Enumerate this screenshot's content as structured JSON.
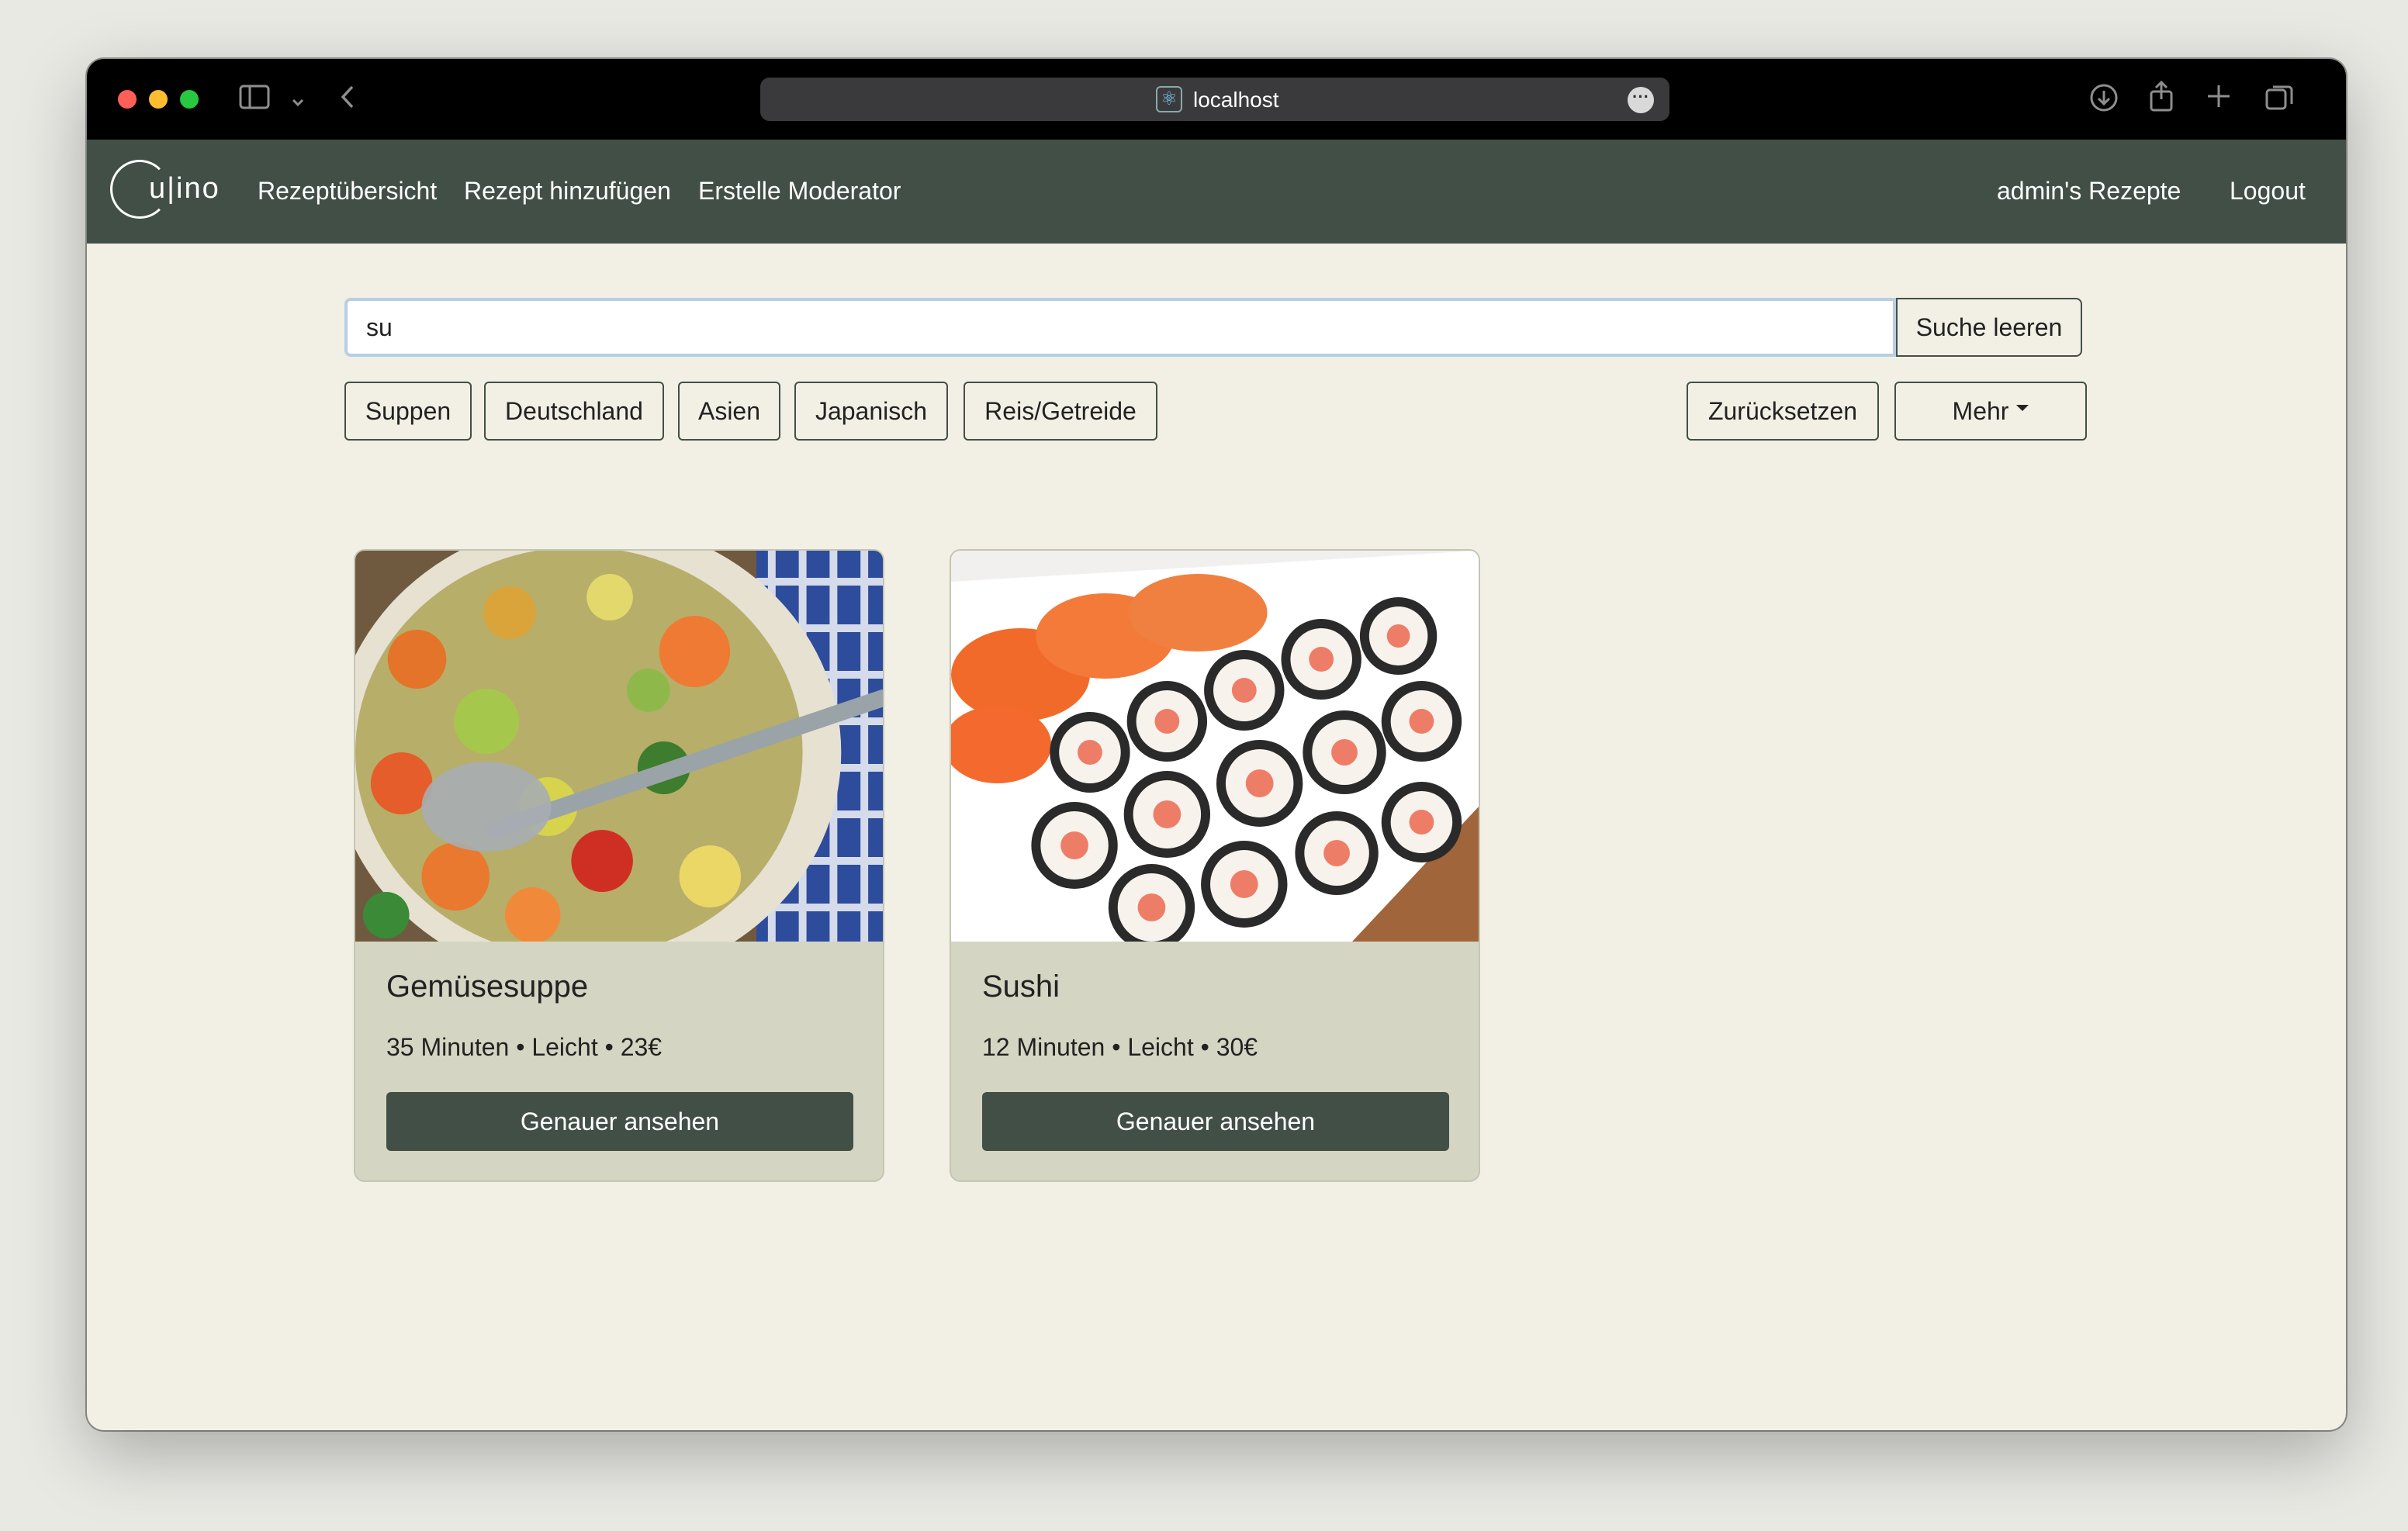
{
  "browser": {
    "url": "localhost"
  },
  "navbar": {
    "logo_text": "u|ino",
    "links": [
      "Rezeptübersicht",
      "Rezept hinzufügen",
      "Erstelle Moderator"
    ],
    "user_recipes": "admin's Rezepte",
    "logout": "Logout"
  },
  "search": {
    "value": "su",
    "clear_label": "Suche leeren"
  },
  "filters": {
    "tags": [
      "Suppen",
      "Deutschland",
      "Asien",
      "Japanisch",
      "Reis/Getreide"
    ],
    "reset_label": "Zurücksetzen",
    "more_label": "Mehr"
  },
  "recipes": [
    {
      "title": "Gemüsesuppe",
      "meta": "35 Minuten • Leicht • 23€",
      "button": "Genauer ansehen",
      "image": "vegetable-soup-photo"
    },
    {
      "title": "Sushi",
      "meta": "12 Minuten • Leicht • 30€",
      "button": "Genauer ansehen",
      "image": "sushi-platter-photo"
    }
  ],
  "colors": {
    "navbar": "#424f47",
    "page_background": "#f2f0e5",
    "card_background": "#d4d6c3",
    "primary_button": "#424f47"
  }
}
